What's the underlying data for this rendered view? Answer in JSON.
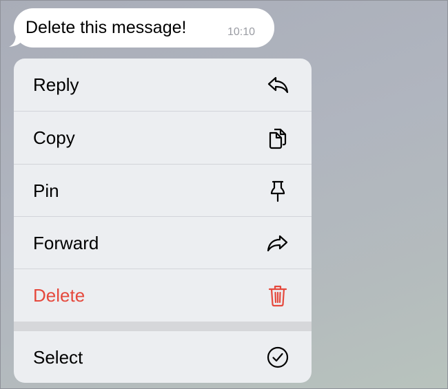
{
  "message": {
    "text": "Delete this message!",
    "time": "10:10"
  },
  "menu": {
    "items": [
      {
        "label": "Reply",
        "icon": "reply-icon"
      },
      {
        "label": "Copy",
        "icon": "copy-icon"
      },
      {
        "label": "Pin",
        "icon": "pin-icon"
      },
      {
        "label": "Forward",
        "icon": "forward-icon"
      },
      {
        "label": "Delete",
        "icon": "trash-icon",
        "color": "#e5493d"
      },
      {
        "label": "Select",
        "icon": "checkmark-circle-icon"
      }
    ]
  },
  "colors": {
    "danger": "#e5493d",
    "menu_background": "#eceef1",
    "bubble_background": "#ffffff"
  }
}
